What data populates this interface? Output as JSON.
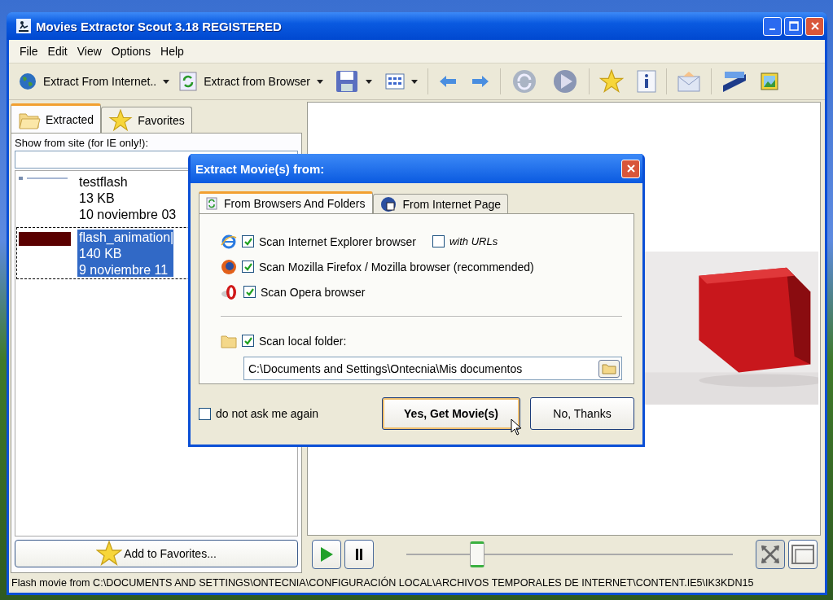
{
  "window": {
    "title": "Movies Extractor Scout 3.18 REGISTERED"
  },
  "menu": [
    "File",
    "Edit",
    "View",
    "Options",
    "Help"
  ],
  "toolbar": {
    "buttons": [
      "Extract From Internet..",
      "Extract from Browser"
    ]
  },
  "tabs": [
    {
      "label": "Extracted",
      "selected": true
    },
    {
      "label": "Favorites",
      "selected": false
    }
  ],
  "site_filter": {
    "label": "Show from site (for IE only!):"
  },
  "movies": [
    {
      "name": "testflash",
      "size": "13 KB",
      "date": "10 noviembre 03",
      "selected": false
    },
    {
      "name": "flash_animation|",
      "size": "140 KB",
      "date": "9 noviembre 11",
      "selected": true
    }
  ],
  "add_favorites": "Add to Favorites...",
  "player": {
    "level": 0.22
  },
  "status_bar": "Flash movie from C:\\DOCUMENTS AND SETTINGS\\ONTECNIA\\CONFIGURACIÓN LOCAL\\ARCHIVOS TEMPORALES DE INTERNET\\CONTENT.IE5\\IK3KDN15",
  "dialog": {
    "title": "Extract Movie(s) from:",
    "tabs": [
      {
        "label": "From Browsers And Folders",
        "selected": true
      },
      {
        "label": "From Internet Page",
        "selected": false
      }
    ],
    "browsers": [
      {
        "label": "Scan Internet Explorer browser",
        "checked": true
      },
      {
        "label": "Scan Mozilla Firefox / Mozilla browser (recommended)",
        "checked": true
      },
      {
        "label": "Scan Opera browser",
        "checked": true
      }
    ],
    "with_urls": {
      "label": "with URLs",
      "checked": false
    },
    "local_folder": {
      "label": "Scan local folder:",
      "checked": true,
      "value": "C:\\Documents and Settings\\Ontecnia\\Mis documentos"
    },
    "dont_ask": {
      "label": "do not ask me again",
      "checked": false
    },
    "buttons": [
      "Yes, Get Movie(s)",
      "No, Thanks"
    ]
  }
}
